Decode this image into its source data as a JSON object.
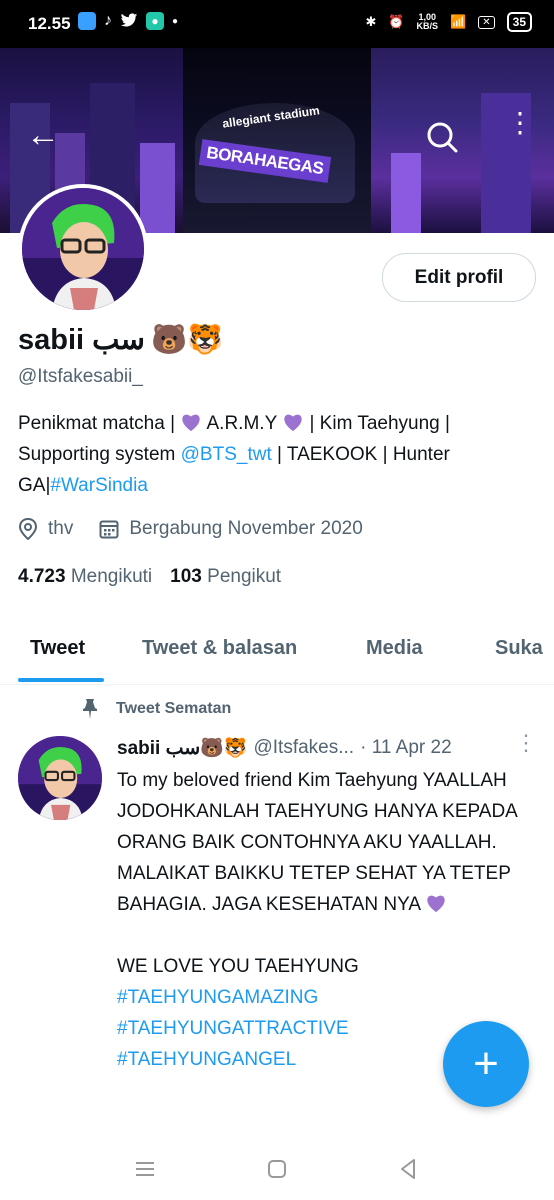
{
  "status_bar": {
    "time": "12.55",
    "net_speed_value": "1,00",
    "net_speed_unit": "KB/S",
    "battery": "35"
  },
  "banner": {
    "stadium_text": "allegiant stadium",
    "sign_text": "BORAHAEGAS"
  },
  "profile": {
    "name": "sabii سب",
    "name_emoji": "🐻🐯",
    "handle": "@Itsfakesabii_",
    "edit_label": "Edit profil",
    "bio_1": "Penikmat matcha | ",
    "bio_2": " A.R.M.Y ",
    "bio_3": " | Kim Taehyung | Supporting system ",
    "bio_mention": "@BTS_twt",
    "bio_4": " | TAEKOOK | Hunter GA|",
    "bio_hashtag": "#WarSindia",
    "location": "thv",
    "joined": "Bergabung November 2020",
    "following_count": "4.723",
    "following_label": "Mengikuti",
    "followers_count": "103",
    "followers_label": "Pengikut"
  },
  "tabs": [
    "Tweet",
    "Tweet & balasan",
    "Media",
    "Suka"
  ],
  "pinned_tweet": {
    "pinned_label": "Tweet Sematan",
    "name": "sabii سب",
    "name_emoji": "🐻🐯",
    "handle": "@Itsfakes...",
    "date": "· 11 Apr 22",
    "text": "To my beloved friend Kim Taehyung YAALLAH JODOHKANLAH TAEHYUNG HANYA KEPADA ORANG BAIK CONTOHNYA AKU YAALLAH. MALAIKAT BAIKKU TETEP SEHAT YA TETEP BAHAGIA. JAGA KESEHATAN NYA",
    "text_2": "WE LOVE YOU TAEHYUNG",
    "hashtags": [
      "#TAEHYUNGAMAZING",
      "#TAEHYUNGATTRACTIVE",
      "#TAEHYUNGANGEL"
    ]
  },
  "colors": {
    "accent": "#1d9bf0",
    "secondary_text": "#536471",
    "heart": "#9b72cf"
  },
  "icons": [
    "back-arrow-icon",
    "search-icon",
    "more-vertical-icon",
    "location-icon",
    "calendar-icon",
    "pin-icon",
    "compose-plus-icon",
    "purple-heart-icon"
  ]
}
